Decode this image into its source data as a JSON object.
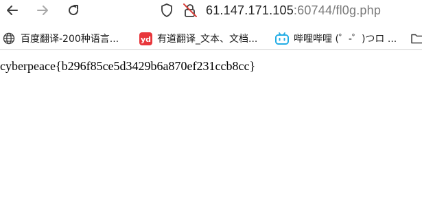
{
  "colors": {
    "icon": "#3c3c3c",
    "icon_disabled": "#a8a8a8",
    "alert": "#d8403b",
    "youdao": "#e8363b",
    "bilibili": "#23ade5"
  },
  "toolbar": {
    "back_icon": "arrow-left-icon",
    "forward_icon": "arrow-right-icon",
    "reload_icon": "reload-icon"
  },
  "urlbar": {
    "host": "61.147.171.105",
    "rest": ":60744/fl0g.php",
    "shield_icon": "shield-icon",
    "insecure_icon": "insecure-lock-icon"
  },
  "bookmarks": [
    {
      "label": "百度翻译-200种语言...",
      "icon": "globe-icon"
    },
    {
      "label": "有道翻译_文本、文档...",
      "icon": "youdao-icon"
    },
    {
      "label": "哔哩哔哩 (゜-゜)つロ ...",
      "icon": "bilibili-icon"
    },
    {
      "label": "",
      "icon": "folder-icon"
    }
  ],
  "page": {
    "text": "cyberpeace{b296f85ce5d3429b6a870ef231ccb8cc}"
  }
}
